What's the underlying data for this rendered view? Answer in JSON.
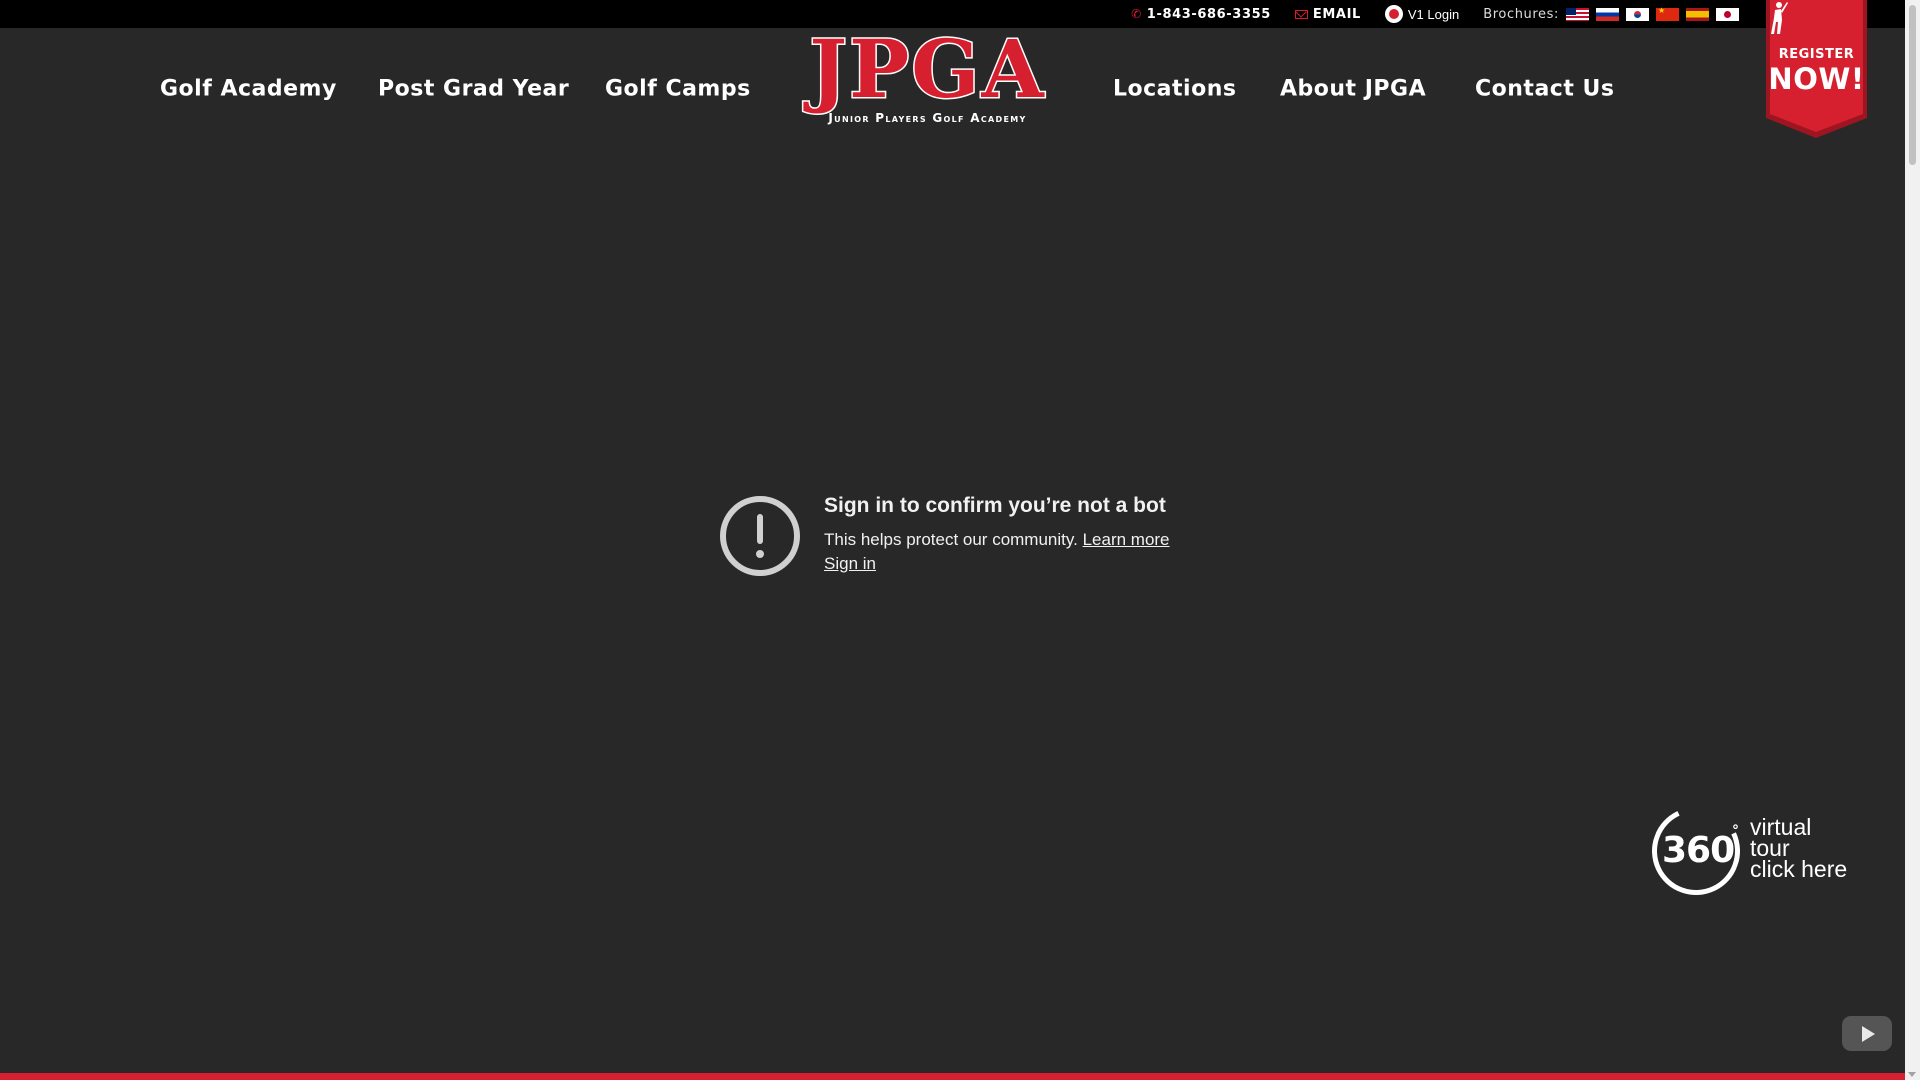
{
  "topbar": {
    "phone": "1-843-686-3355",
    "email_label": "EMAIL",
    "v1_login": "V1 Login",
    "brochures_label": "Brochures:",
    "brochure_flags": [
      "us-flag-icon",
      "ru-flag-icon",
      "kr-flag-icon",
      "cn-flag-icon",
      "es-flag-icon",
      "jp-flag-icon"
    ]
  },
  "nav": {
    "left": [
      "Golf Academy",
      "Post Grad Year",
      "Golf Camps"
    ],
    "right": [
      "Locations",
      "About JPGA",
      "Contact Us"
    ]
  },
  "logo": {
    "mark": "JPGA",
    "subtitle": "Junior Players Golf Academy"
  },
  "register": {
    "line1": "REGISTER",
    "line2": "NOW!"
  },
  "notice": {
    "title": "Sign in to confirm you’re not a bot",
    "text": "This helps protect our community.",
    "learn_more": "Learn more",
    "sign_in": "Sign in"
  },
  "tour": {
    "number": "360",
    "degree": "°",
    "line1": "virtual",
    "line2": "tour",
    "line3": "click here"
  },
  "colors": {
    "brand_red": "#d6202f",
    "background": "#282828",
    "topbar": "#000000"
  }
}
